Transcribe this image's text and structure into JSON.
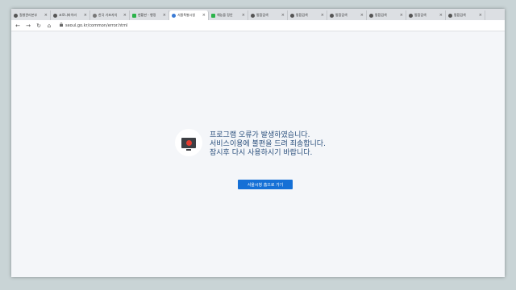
{
  "tabs": [
    {
      "label": "질병관리본부",
      "color": "#555555"
    },
    {
      "label": "코로나바이러",
      "color": "#555555"
    },
    {
      "label": "한국 기초자치",
      "color": "#777777"
    },
    {
      "label": "현황판 - 행정",
      "color": "#2bb34a"
    },
    {
      "label": "서울특별시청",
      "color": "#3a7bd5"
    },
    {
      "label": "해농을 정안",
      "color": "#2bb34a"
    },
    {
      "label": "통합검색",
      "color": "#555555"
    },
    {
      "label": "통합검색",
      "color": "#555555"
    },
    {
      "label": "통합검색",
      "color": "#555555"
    },
    {
      "label": "통합검색",
      "color": "#555555"
    },
    {
      "label": "통합검색",
      "color": "#555555"
    },
    {
      "label": "통합검색",
      "color": "#555555"
    }
  ],
  "tab_close_symbol": "×",
  "toolbar": {
    "back_symbol": "←",
    "forward_symbol": "→",
    "reload_symbol": "↻",
    "home_symbol": "⌂",
    "url": "seoul.go.kr/common/error.html"
  },
  "error": {
    "icon": "monitor-error-icon",
    "lines": [
      "프로그램 오류가 발생하였습니다.",
      "서비스이용에 불편을 드려 죄송합니다.",
      "잠시후 다시 사용하시기 바랍니다."
    ],
    "button_label": "서울시청 홈으로 가기"
  },
  "colors": {
    "accent": "#1570d6",
    "message_text": "#2a4f7c",
    "error_dot": "#e53b2f"
  }
}
